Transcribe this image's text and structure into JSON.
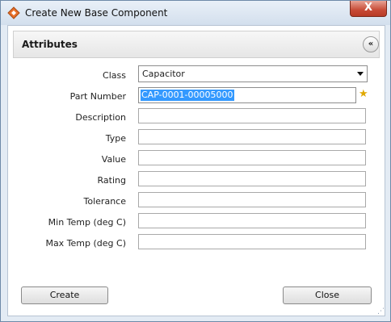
{
  "window": {
    "title": "Create New Base Component",
    "close_label": "X"
  },
  "section": {
    "title": "Attributes",
    "collapse_label": "«"
  },
  "form": {
    "class_label": "Class",
    "class_value": "Capacitor",
    "part_number_label": "Part Number",
    "part_number_value": "CAP-0001-00005000",
    "description_label": "Description",
    "type_label": "Type",
    "value_label": "Value",
    "rating_label": "Rating",
    "tolerance_label": "Tolerance",
    "min_temp_label": "Min Temp (deg C)",
    "max_temp_label": "Max Temp (deg C)"
  },
  "buttons": {
    "create_label": "Create",
    "close_label": "Close"
  },
  "colors": {
    "selection": "#3399ff",
    "star": "#e0a800",
    "close_button": "#c74b36"
  },
  "icons": {
    "app": "diamond-app-icon",
    "star": "star-icon",
    "collapse": "double-chevron-up-icon"
  }
}
